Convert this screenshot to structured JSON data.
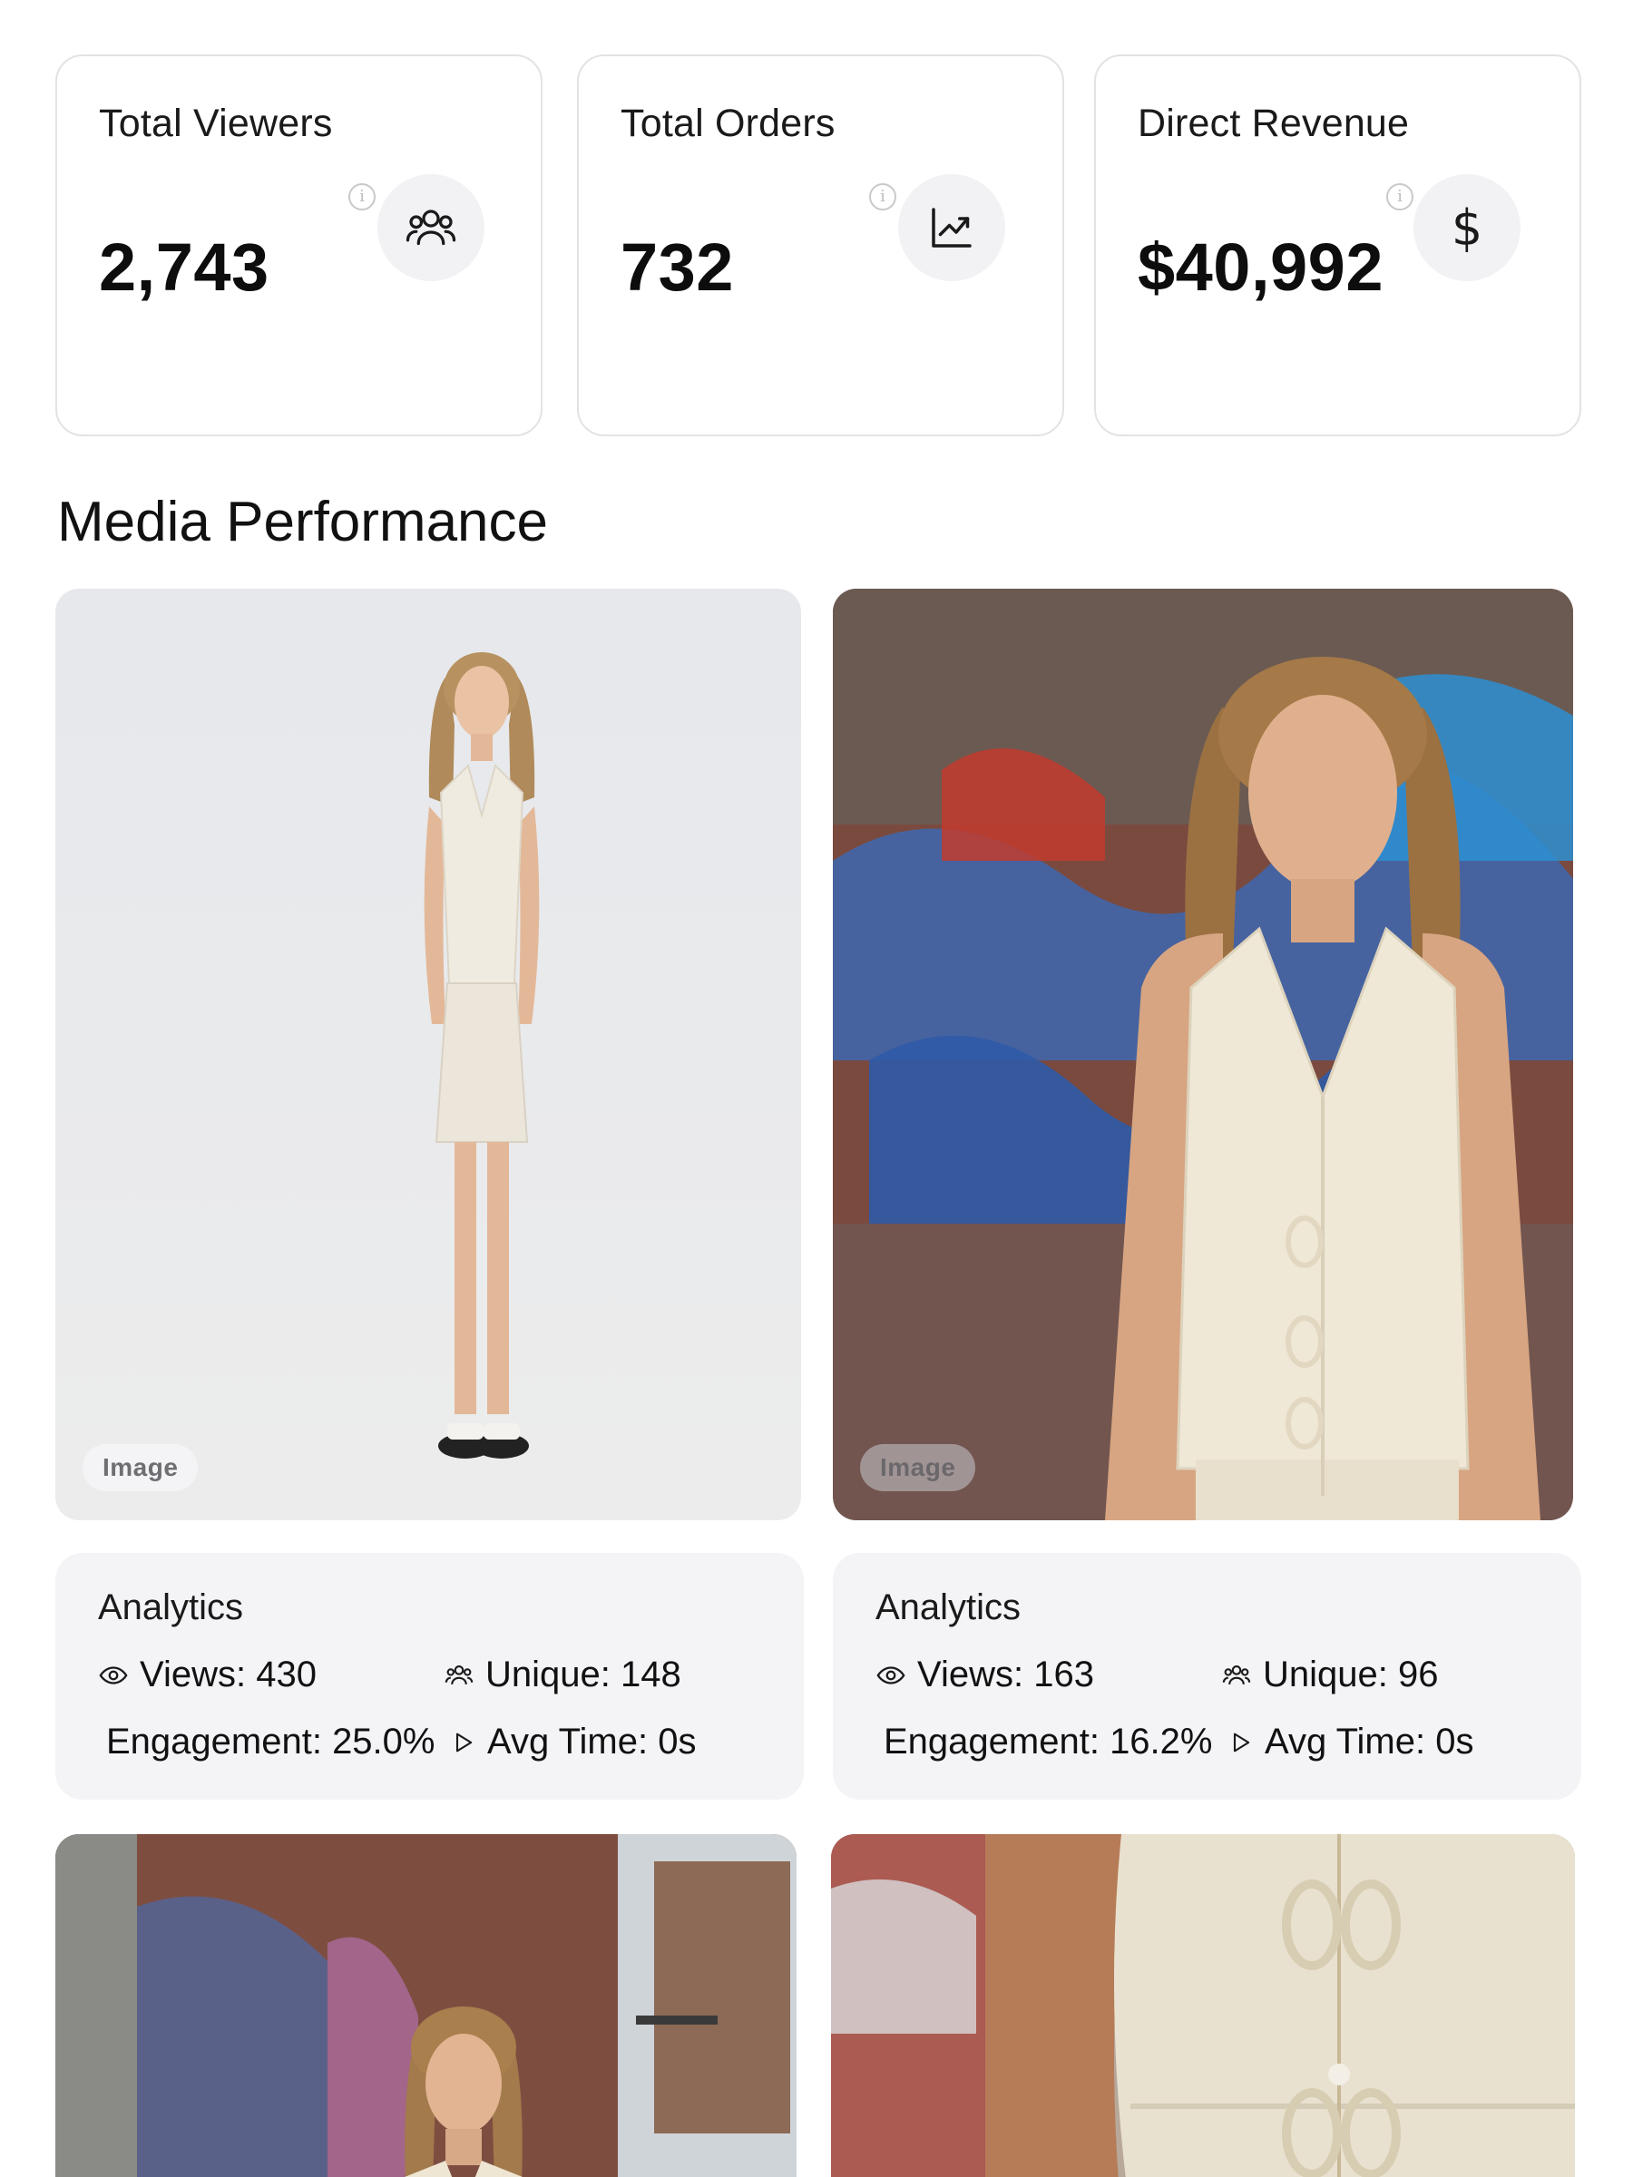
{
  "stats": [
    {
      "title": "Total Viewers",
      "value": "2,743",
      "icon": "users-icon"
    },
    {
      "title": "Total Orders",
      "value": "732",
      "icon": "trending-chart-icon"
    },
    {
      "title": "Direct Revenue",
      "value": "$40,992",
      "icon": "dollar-icon",
      "glyph": "$"
    }
  ],
  "info_glyph": "i",
  "section_title": "Media Performance",
  "media": [
    {
      "badge": "Image",
      "scene": "model in white knit vest and skirt, studio backdrop"
    },
    {
      "badge": "Image",
      "scene": "model in white knit vest, graffiti brick wall"
    }
  ],
  "analytics": [
    {
      "title": "Analytics",
      "views": "Views: 430",
      "unique": "Unique: 148",
      "engagement": "Engagement: 25.0%",
      "avg_time": "Avg Time: 0s"
    },
    {
      "title": "Analytics",
      "views": "Views: 163",
      "unique": "Unique: 96",
      "engagement": "Engagement: 16.2%",
      "avg_time": "Avg Time: 0s"
    }
  ],
  "colors": {
    "card_border": "#e3e3e6",
    "icon_bg": "#f2f1f4",
    "analytics_bg": "#f4f3f6"
  }
}
